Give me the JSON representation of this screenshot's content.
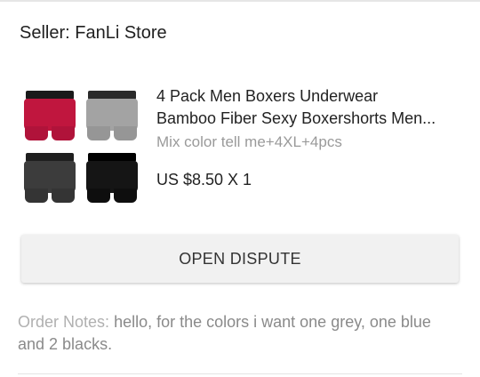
{
  "seller": {
    "label": "Seller: FanLi Store"
  },
  "product": {
    "title_line1": "4 Pack Men Boxers Underwear",
    "title_line2": "Bamboo Fiber Sexy Boxershorts Men...",
    "variant": "Mix color tell me+4XL+4pcs",
    "price": "US $8.50 X 1",
    "image_colors": [
      "#c0163e",
      "#9e9e9e",
      "#3a3a3a",
      "#111111"
    ]
  },
  "actions": {
    "open_dispute_label": "OPEN DISPUTE"
  },
  "notes": {
    "label": "Order Notes:",
    "value": "hello, for the colors i want one grey, one blue and 2 blacks."
  }
}
